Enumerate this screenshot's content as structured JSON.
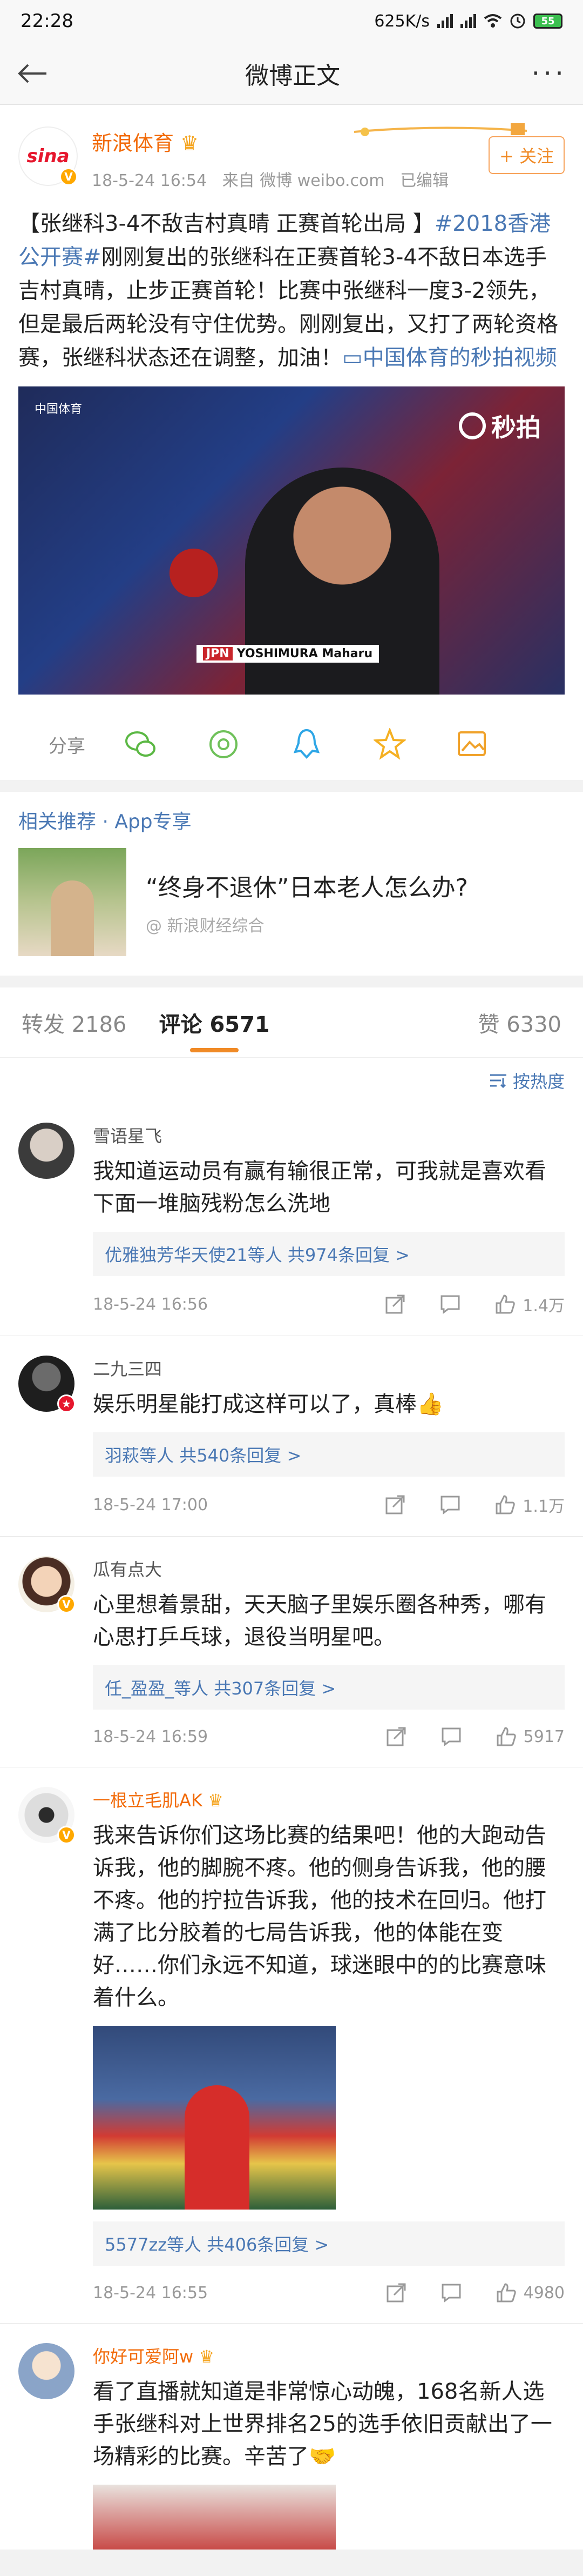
{
  "statusbar": {
    "time": "22:28",
    "speed": "625K/s",
    "battery": "55"
  },
  "nav": {
    "title": "微博正文"
  },
  "post": {
    "author": "新浪体育",
    "meta_time": "18-5-24 16:54",
    "meta_source": "来自 微博 weibo.com",
    "meta_edited": "已编辑",
    "follow_label": "+ 关注",
    "text_headline": "【张继科3-4不敌吉村真晴 正赛首轮出局 】",
    "text_topic": "#2018香港公开赛#",
    "text_body": "刚刚复出的张继科在正赛首轮3-4不敌日本选手吉村真晴，止步正赛首轮！比赛中张继科一度3-2领先，但是最后两轮没有守住优势。刚刚复出，又打了两轮资格赛，张继科状态还在调整，加油！",
    "text_video_link": "中国体育的秒拍视频",
    "video": {
      "watermark": "秒拍",
      "channel": "中国体育",
      "player_tag": "JPN",
      "player_name": "YOSHIMURA Maharu"
    },
    "share_label": "分享"
  },
  "recommend": {
    "header": "相关推荐 · App专享",
    "title": "“终身不退休”日本老人怎么办?",
    "source": "@ 新浪财经综合"
  },
  "tabs": {
    "repost": "转发 2186",
    "comments": "评论 6571",
    "likes": "赞 6330"
  },
  "sort_label": "按热度",
  "comments": [
    {
      "name": "雪语星飞",
      "text": "我知道运动员有赢有输很正常，可我就是喜欢看下面一堆脑残粉怎么洗地",
      "reply_users": "优雅独芳华天使21等人",
      "reply_count": "共974条回复 >",
      "time": "18-5-24 16:56",
      "likes": "1.4万"
    },
    {
      "name": "二九三四",
      "text": "娱乐明星能打成这样可以了，真棒👍",
      "reply_users": "羽萩等人",
      "reply_count": "共540条回复 >",
      "time": "18-5-24 17:00",
      "likes": "1.1万"
    },
    {
      "name": "瓜有点大",
      "text": "心里想着景甜，天天脑子里娱乐圈各种秀，哪有心思打乒乓球，退役当明星吧。",
      "reply_users": "任_盈盈_等人",
      "reply_count": "共307条回复 >",
      "time": "18-5-24 16:59",
      "likes": "5917"
    },
    {
      "name": "一根立毛肌AK",
      "text": "我来告诉你们这场比赛的结果吧！他的大跑动告诉我，他的脚腕不疼。他的侧身告诉我，他的腰不疼。他的拧拉告诉我，他的技术在回归。他打满了比分胶着的七局告诉我，他的体能在变好……你们永远不知道，球迷眼中的的比赛意味着什么。",
      "reply_users": "5577zz等人",
      "reply_count": "共406条回复 >",
      "time": "18-5-24 16:55",
      "likes": "4980"
    },
    {
      "name": "你好可爱阿w",
      "text": "看了直播就知道是非常惊心动魄，168名新人选手张继科对上世界排名25的选手依旧贡献出了一场精彩的比赛。辛苦了🤝"
    }
  ]
}
